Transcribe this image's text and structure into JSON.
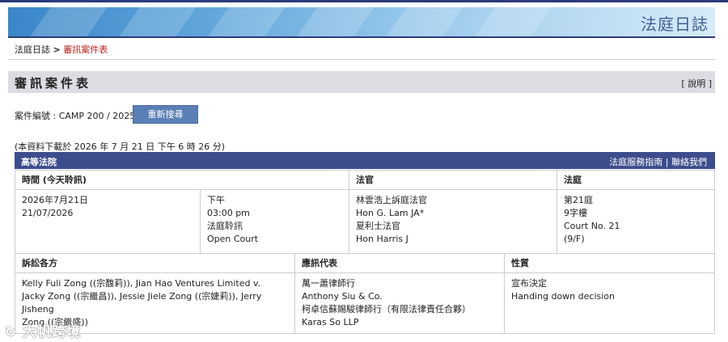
{
  "banner": {
    "title": "法庭日誌"
  },
  "breadcrumb": {
    "home": "法庭日誌",
    "sep": ">",
    "current": "審訊案件表"
  },
  "heading": {
    "title": "審訊案件表",
    "help": "[ 說明 ]"
  },
  "case": {
    "label": "案件編號 : CAMP 200 / 2025",
    "button": "重新搜尋"
  },
  "download_note": "(本資料下載於 2026 年 7 月 21 日 下午 6 時 26 分)",
  "court_bar": {
    "name": "高等法院",
    "links": "法庭服務指南 | 聯絡我們"
  },
  "schedule": {
    "headers": {
      "time": "時間 (今天聆訊)",
      "judge": "法官",
      "court": "法庭"
    },
    "date": [
      "2026年7月21日",
      "21/07/2026"
    ],
    "time": [
      "下午",
      "03:00 pm",
      "法庭聆訊",
      "Open Court"
    ],
    "judge": [
      "林雲浩上訴庭法官",
      "Hon G. Lam JA*",
      "夏利士法官",
      "Hon Harris J"
    ],
    "court": [
      "第21庭",
      "9字樓",
      "Court No. 21",
      "(9/F)"
    ]
  },
  "parties": {
    "headers": {
      "parties": "訴訟各方",
      "reps": "應訊代表",
      "nature": "性質"
    },
    "parties": [
      "Kelly Fuli Zong ((宗馥莉)), Jian Hao Ventures Limited v.",
      "Jacky Zong ((宗繼昌)), Jessie Jiele Zong ((宗婕莉)), Jerry Jisheng",
      "Zong ((宗繼盛))"
    ],
    "reps": [
      "萬一蕭律師行",
      "Anthony Siu & Co.",
      "柯卓信蘇賜駿律師行（有限法律責任合夥）",
      "Karas So LLP"
    ],
    "nature": [
      "宣布決定",
      "Handing down decision"
    ]
  },
  "watermark": "大帆跨境"
}
